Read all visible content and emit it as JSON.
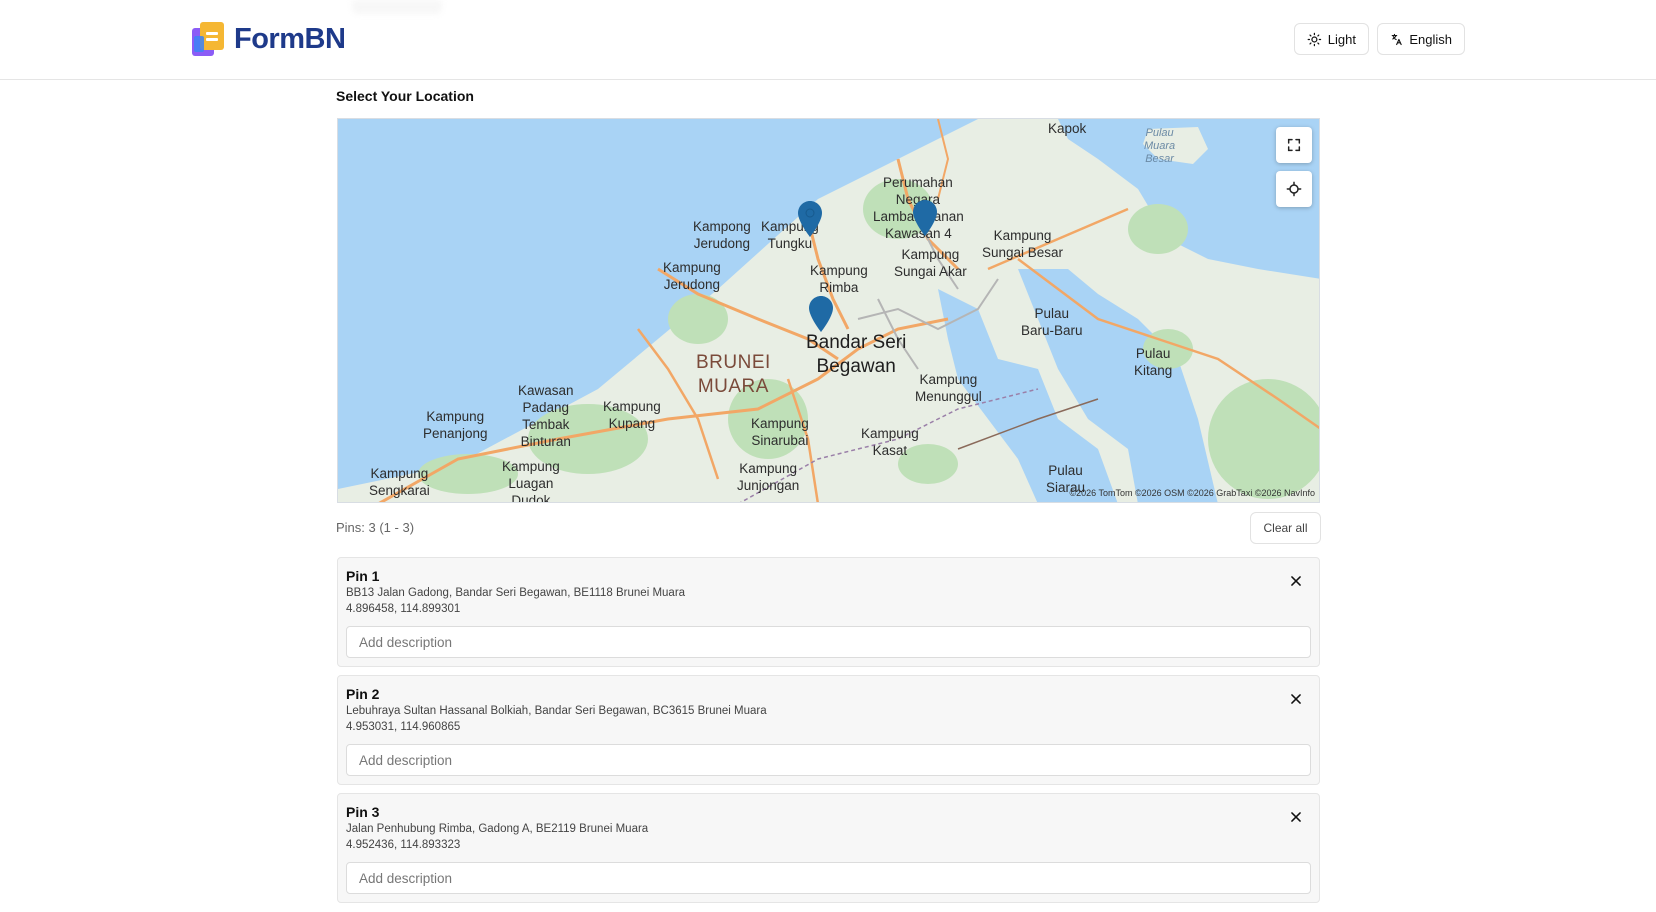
{
  "header": {
    "app_name": "FormBN",
    "theme_label": "Light",
    "language_label": "English"
  },
  "location": {
    "title": "Select Your Location"
  },
  "map": {
    "labels": {
      "kapok": "Kapok",
      "pulau_muara_besar": "Pulau\nMuara\nBesar",
      "perumahan_negara": "Perumahan\nNegara",
      "lambak_kanan": "Lambak Kanan\nKawasan 4",
      "kampong_jerudong_1": "Kampong\nJerudong",
      "kampung_tungku": "Kampung\nTungku",
      "kampung_jerudong_2": "Kampung\nJerudong",
      "kampung_rimba": "Kampung\nRimba",
      "kampung_sungai_akar": "Kampung\nSungai Akar",
      "kampung_sungai_besar": "Kampung\nSungai Besar",
      "pulau_baru_baru": "Pulau\nBaru-Baru",
      "bandar_seri_begawan": "Bandar Seri\nBegawan",
      "brunei_muara": "BRUNEI\nMUARA",
      "pulau_kitang": "Pulau\nKitang",
      "kampung_menunggul": "Kampung\nMenunggul",
      "kawasan_padang": "Kawasan\nPadang\nTembak\nBinturan",
      "kampung_kupang": "Kampung\nKupang",
      "kampung_penanjong": "Kampung\nPenanjong",
      "kampung_sinarubai": "Kampung\nSinarubai",
      "kampung_kasat": "Kampung\nKasat",
      "kampung_sengkarai": "Kampung\nSengkarai",
      "kampung_luagan": "Kampung\nLuagan\nDudok",
      "kampung_junjongan": "Kampung\nJunjongan",
      "pulau_siarau": "Pulau\nSiarau"
    },
    "attribution": "©2026 TomTom  ©2026 OSM  ©2026 GrabTaxi  ©2026 NavInfo",
    "fullscreen_icon": "fullscreen-icon",
    "locate_icon": "crosshair-icon",
    "pin_color": "#1f6aa5"
  },
  "pins": {
    "summary": "Pins: 3 (1 - 3)",
    "clear_label": "Clear all",
    "items": [
      {
        "title": "Pin 1",
        "address": "BB13 Jalan Gadong, Bandar Seri Begawan, BE1118 Brunei Muara",
        "coords": "4.896458, 114.899301",
        "description_placeholder": "Add description",
        "description_value": ""
      },
      {
        "title": "Pin 2",
        "address": "Lebuhraya Sultan Hassanal Bolkiah, Bandar Seri Begawan, BC3615 Brunei Muara",
        "coords": "4.953031, 114.960865",
        "description_placeholder": "Add description",
        "description_value": ""
      },
      {
        "title": "Pin 3",
        "address": "Jalan Penhubung Rimba, Gadong A, BE2119 Brunei Muara",
        "coords": "4.952436, 114.893323",
        "description_placeholder": "Add description",
        "description_value": ""
      }
    ]
  }
}
